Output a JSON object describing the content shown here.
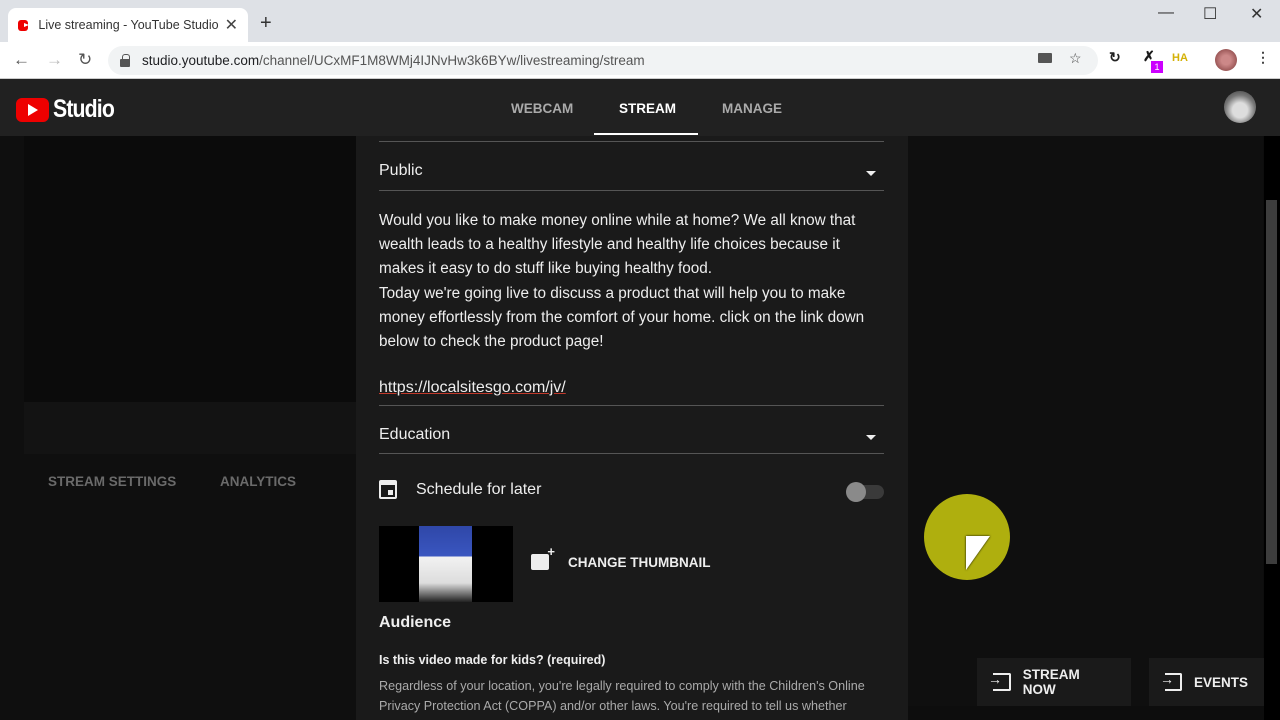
{
  "browser": {
    "tab_title": "Live streaming - YouTube Studio",
    "new_tab": "+",
    "url_host": "studio.youtube.com",
    "url_path": "/channel/UCxMF1M8WMj4IJNvHw3k6BYw/livestreaming/stream",
    "window_controls": {
      "minimize": "—",
      "maximize": "☐",
      "close": "✕"
    },
    "nav": {
      "back": "←",
      "forward": "→",
      "reload": "↻"
    },
    "extensions": [
      "camera-icon",
      "star-icon",
      "sync-extension-icon",
      "x-extension-icon",
      "ha-extension-icon"
    ],
    "extension_badge": "1",
    "menu": "⋮"
  },
  "header": {
    "logo_text": "Studio",
    "tabs": [
      {
        "label": "WEBCAM",
        "active": false
      },
      {
        "label": "STREAM",
        "active": true
      },
      {
        "label": "MANAGE",
        "active": false
      }
    ]
  },
  "left": {
    "tabs": [
      "STREAM SETTINGS",
      "ANALYTICS"
    ]
  },
  "form": {
    "visibility": "Public",
    "description": "Would you like to make money online while at home? We all know that wealth leads to a healthy lifestyle and healthy life choices because it makes it easy to do stuff like buying healthy food.\nToday we're going live to discuss a product that will help you to make money effortlessly from the comfort of your home. click on the link down below to check the product page!",
    "link": "https://localsitesgo.com/jv/",
    "category": "Education",
    "schedule_label": "Schedule for later",
    "schedule_enabled": false,
    "change_thumbnail": "CHANGE THUMBNAIL",
    "audience_heading": "Audience",
    "kids_question": "Is this video made for kids? (required)",
    "coppa_text": "Regardless of your location, you're legally required to comply with the Children's Online Privacy Protection Act (COPPA) and/or other laws. You're required to tell us whether"
  },
  "actions": {
    "stream_now": "STREAM NOW",
    "events": "EVENTS"
  },
  "colors": {
    "brand_red": "#ff0000",
    "header_bg": "#212121",
    "panel_bg": "#1a1a1a",
    "cursor_highlight": "#b8b80f"
  }
}
